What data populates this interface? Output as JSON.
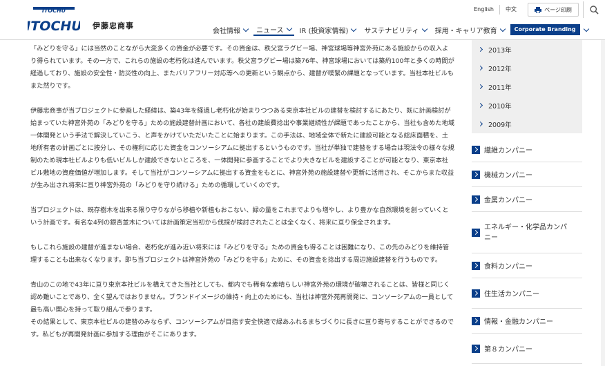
{
  "header": {
    "logo_text": "ITOCHU",
    "logo_jp": "伊藤忠商事",
    "lang_en": "English",
    "lang_zh": "中文",
    "print_label": "ページ印刷",
    "nav": [
      {
        "label": "会社情報"
      },
      {
        "label": "ニュース"
      },
      {
        "label": "IR (投資家情報)"
      },
      {
        "label": "サステナビリティ"
      },
      {
        "label": "採用・キャリア教育"
      }
    ],
    "corporate_branding": "Corporate Branding"
  },
  "main": {
    "paragraphs": [
      "「みどりを守る」には当然のことながら大変多くの資金が必要です。その資金は、秩父宮ラグビー場、神宮球場等神宮外苑にある施設からの収入より得られています。その一方で、これらの施設の老朽化は進んでいます。秩父宮ラグビー場は築76年、神宮球場においては築約100年と多くの時間が経過しており、施設の安全性・防災性の向上、またバリアフリー対応等への更新という観点から、建替が喫緊の課題となっています。当社本社ビルもまた然りです。",
      "伊藤忠商事が当プロジェクトに参画した経緯は、築43年を経過し老朽化が始まりつつある東京本社ビルの建替を検討するにあたり、既に計画検討が始まっていた神宮外苑の「みどりを守る」ための施設建替計画において、各社の建設費捻出や事業継続性が課題であったことから、当社も含めた地域一体開発という手法で解決していこう、と声をかけていただいたことに始まります。この手法は、地域全体で新たに建設可能となる総床面積を、土地所有者の計画ごとに按分し、その権利に応じた資金をコンソーシアムに拠出するというものです。当社が単独で建替をする場合は現法令の様々な規制のため現本社ビルよりも低いビルしか建設できないところを、一体開発に参画することでより大きなビルを建設することが可能となり、東京本社ビル敷地の資産価値が増加します。そして当社がコンソーシアムに拠出する資金をもとに、神宮外苑の施設建替や更新に活用され、そこからまた収益が生み出され将来に亘り神宮外苑の「みどりを守り続ける」ための循環していくのです。",
      "当プロジェクトは、既存樹木を出来る限り守りながら移植や新植もおこない、緑の量をこれまでよりも増やし、より豊かな自然環境を創っていくという計画です。有名な4列の銀杏並木については計画策定当初から伐採が検討されたことは全くなく、将来に亘り保全されます。",
      "もしこれら施設の建替が進まない場合、老朽化が進み近い将来には「みどりを守る」ための資金も得ることは困難になり、この先のみどりを維持管理することも出来なくなります。即ち当プロジェクトは神宮外苑の「みどりを守る」ために、その資金を捻出する周辺施設建替を行うものです。",
      "青山のこの地で43年に亘り東京本社ビルを構えてきた当社としても、都内でも稀有な素晴らしい神宮外苑の環境が破壊されることは、皆様と同じく認め難いことであり、全く望んではおりません。ブランドイメージの維持・向上のためにも、当社は神宮外苑再開発に、コンソーシアムの一員として最も高い関心を持って取り組んで参ります。",
      "その結果として、東京本社ビルの建替のみならず、コンソーシアムが目指す安全快適で緑あふれるまちづくりに長きに亘り寄与することができるのです。私どもが再開発計画に参加する理由がそこにあります。"
    ]
  },
  "sidebar": {
    "years": [
      "2013年",
      "2012年",
      "2011年",
      "2010年",
      "2009年"
    ],
    "companies": [
      "繊維カンパニー",
      "機械カンパニー",
      "金属カンパニー",
      "エネルギー・化学品カンパニー",
      "食料カンパニー",
      "住生活カンパニー",
      "情報・金融カンパニー",
      "第８カンパニー"
    ]
  },
  "colors": {
    "brand_blue": "#0b3f8a",
    "sidebar_bg": "#efefef"
  }
}
